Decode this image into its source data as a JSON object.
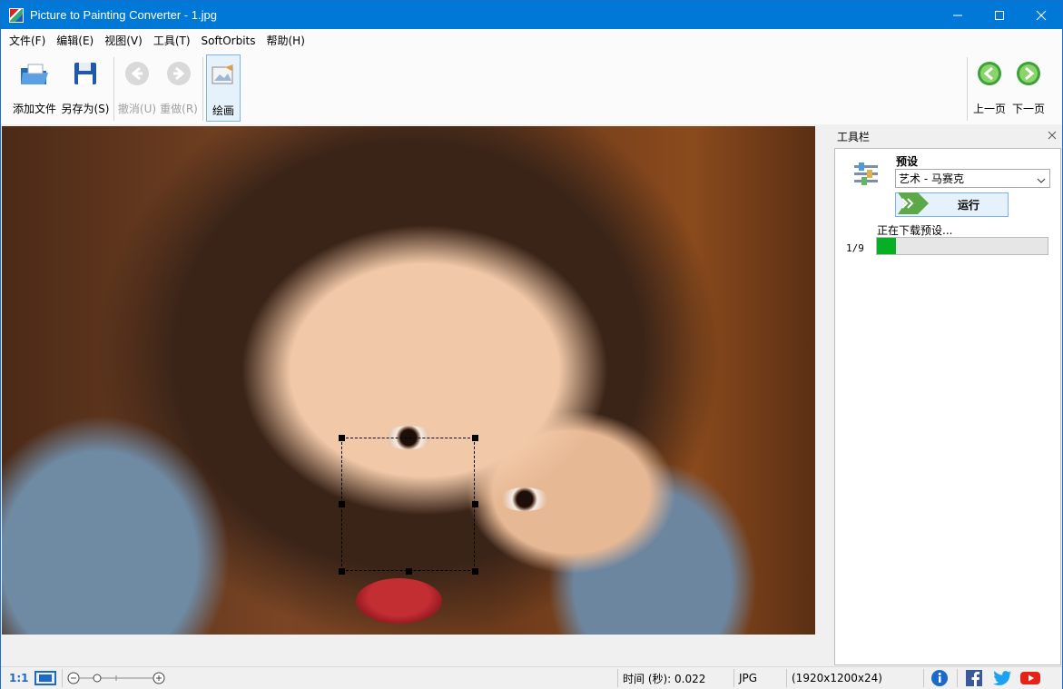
{
  "window": {
    "title": "Picture to Painting Converter - 1.jpg"
  },
  "menu": [
    "文件(F)",
    "编辑(E)",
    "视图(V)",
    "工具(T)",
    "SoftOrbits",
    "帮助(H)"
  ],
  "toolbar": {
    "add_files": "添加文件",
    "save_as": "另存为(S)",
    "undo": "撤消(U)",
    "redo": "重做(R)",
    "paint": "绘画",
    "prev_page": "上一页",
    "next_page": "下一页"
  },
  "panel": {
    "title": "工具栏",
    "preset_label": "预设",
    "preset_value": "艺术 - 马赛克",
    "run_label": "运行",
    "status_text": "正在下载预设...",
    "counter": "1/9",
    "progress": 0.11
  },
  "statusbar": {
    "zoom_label": "1:1",
    "time_text": "时间 (秒): 0.022",
    "format": "JPG",
    "dimensions": "(1920x1200x24)"
  },
  "colors": {
    "title_bar": "#0078d7",
    "progress_fill": "#06b025",
    "accent": "#7eb4ea"
  }
}
